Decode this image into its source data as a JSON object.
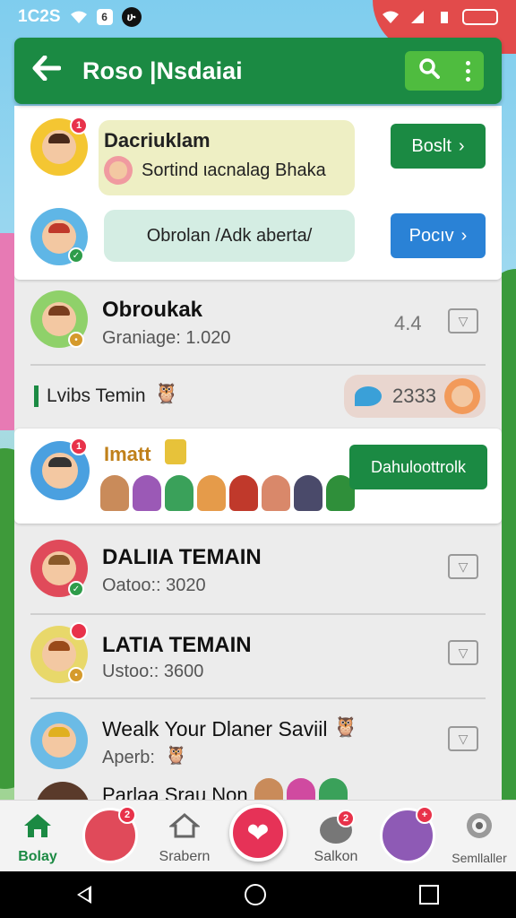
{
  "status_bar": {
    "time": "1C2S"
  },
  "app_bar": {
    "title": "Roso |Nsdaiai"
  },
  "messages": [
    {
      "sender": "Dacriuklam",
      "text": "Sortind ιacnalag Bhaka",
      "button": "Boslt",
      "badge": "1"
    },
    {
      "text": "Obrolan /Adk aberta/",
      "button": "Pocıv"
    }
  ],
  "list_item_1": {
    "name": "Obroukak",
    "sub": "Graniage: 1.020",
    "count": "4.4"
  },
  "section": {
    "label": "Lvibs Temin",
    "chip_value": "2333"
  },
  "team_card": {
    "label": "Imatt",
    "button": "Dahuloottrolk",
    "badge": "1"
  },
  "rows": [
    {
      "name": "DALIIA TEMAIN",
      "sub": "Oatoo:: 3020"
    },
    {
      "name": "LATIA TEMAIN",
      "sub": "Ustoo:: 3600"
    },
    {
      "name": "Wealk Your Dlaner Saviil",
      "sub": "Aperb:"
    },
    {
      "name": "Parlaa Srau Non"
    }
  ],
  "bottom_nav": [
    {
      "label": "Bolay"
    },
    {
      "label": "",
      "badge": "2"
    },
    {
      "label": "Srabern"
    },
    {
      "label": ""
    },
    {
      "label": "Salkon",
      "badge": "2"
    },
    {
      "label": ""
    },
    {
      "label": "Semllaller"
    }
  ],
  "colors": {
    "primary": "#1b8a43",
    "accent_blue": "#2a82d6",
    "fab": "#e63257"
  }
}
